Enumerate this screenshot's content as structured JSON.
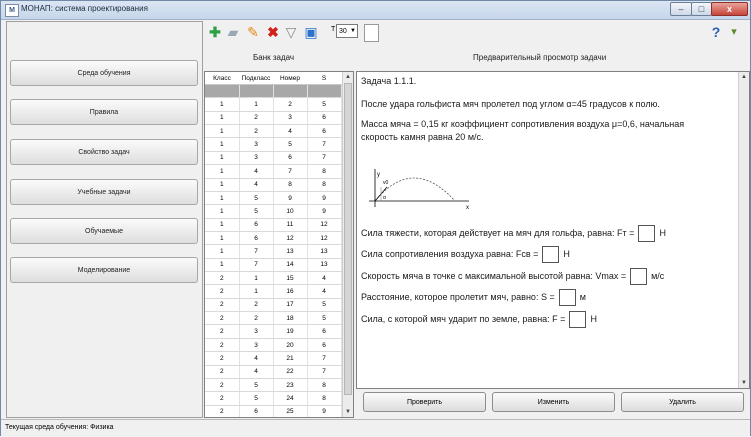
{
  "window": {
    "title": "МОНАП: система проектирования",
    "min": "–",
    "max": "□",
    "close": "x"
  },
  "sidebar": {
    "items": [
      "Среда обучения",
      "Правила",
      "Свойство задач",
      "Учебные задачи",
      "Обучаемые",
      "Моделирование"
    ]
  },
  "toolbar": {
    "font_label": "T",
    "font_size": "30",
    "icons": [
      "add-icon",
      "eraser-icon",
      "pencil-icon",
      "delete-icon",
      "filter-icon",
      "image-icon",
      "font-size-select",
      "page-icon",
      "help-icon",
      "brush-icon"
    ]
  },
  "headers": {
    "bank": "Банк задач",
    "preview": "Предварительный просмотр задачи"
  },
  "table": {
    "columns": [
      "Класс",
      "Подкласс",
      "Номер",
      "S"
    ],
    "rows": [
      [
        "1",
        "1",
        "1",
        "1"
      ],
      [
        "1",
        "1",
        "2",
        "5"
      ],
      [
        "1",
        "2",
        "3",
        "6"
      ],
      [
        "1",
        "2",
        "4",
        "6"
      ],
      [
        "1",
        "3",
        "5",
        "7"
      ],
      [
        "1",
        "3",
        "6",
        "7"
      ],
      [
        "1",
        "4",
        "7",
        "8"
      ],
      [
        "1",
        "4",
        "8",
        "8"
      ],
      [
        "1",
        "5",
        "9",
        "9"
      ],
      [
        "1",
        "5",
        "10",
        "9"
      ],
      [
        "1",
        "6",
        "11",
        "12"
      ],
      [
        "1",
        "6",
        "12",
        "12"
      ],
      [
        "1",
        "7",
        "13",
        "13"
      ],
      [
        "1",
        "7",
        "14",
        "13"
      ],
      [
        "2",
        "1",
        "15",
        "4"
      ],
      [
        "2",
        "1",
        "16",
        "4"
      ],
      [
        "2",
        "2",
        "17",
        "5"
      ],
      [
        "2",
        "2",
        "18",
        "5"
      ],
      [
        "2",
        "3",
        "19",
        "6"
      ],
      [
        "2",
        "3",
        "20",
        "6"
      ],
      [
        "2",
        "4",
        "21",
        "7"
      ],
      [
        "2",
        "4",
        "22",
        "7"
      ],
      [
        "2",
        "5",
        "23",
        "8"
      ],
      [
        "2",
        "5",
        "24",
        "8"
      ],
      [
        "2",
        "6",
        "25",
        "9"
      ],
      [
        "2",
        "6",
        "26",
        "9"
      ]
    ]
  },
  "preview": {
    "task_title": "Задача 1.1.1.",
    "line1": "После удара гольфиста мяч пролетел под углом α=45 градусов к полю.",
    "line2a": "Масса мяча = 0,15 кг коэффициент сопротивления воздуха μ=0,6, начальная",
    "line2b": "скорость камня равна 20 м/с.",
    "diagram_labels": {
      "y": "y",
      "v": "v0",
      "alpha": "α",
      "x": "x"
    },
    "questions": [
      {
        "pre": "Сила тяжести, которая действует на мяч для гольфа, равна: Fт =",
        "unit": "Н"
      },
      {
        "pre": "Сила сопротивления воздуха равна: Fсв =",
        "unit": "Н"
      },
      {
        "pre": "Скорость мяча в точке с максимальной высотой равна: Vmax =",
        "unit": "м/с"
      },
      {
        "pre": "Расстояние, которое пролетит мяч, равно: S =",
        "unit": "м"
      },
      {
        "pre": "Сила, с которой мяч ударит по земле, равна: F =",
        "unit": "Н"
      }
    ]
  },
  "actions": {
    "check": "Проверить",
    "edit": "Изменить",
    "delete": "Удалить"
  },
  "status": {
    "text": "Текущая среда обучения:  Физика"
  }
}
